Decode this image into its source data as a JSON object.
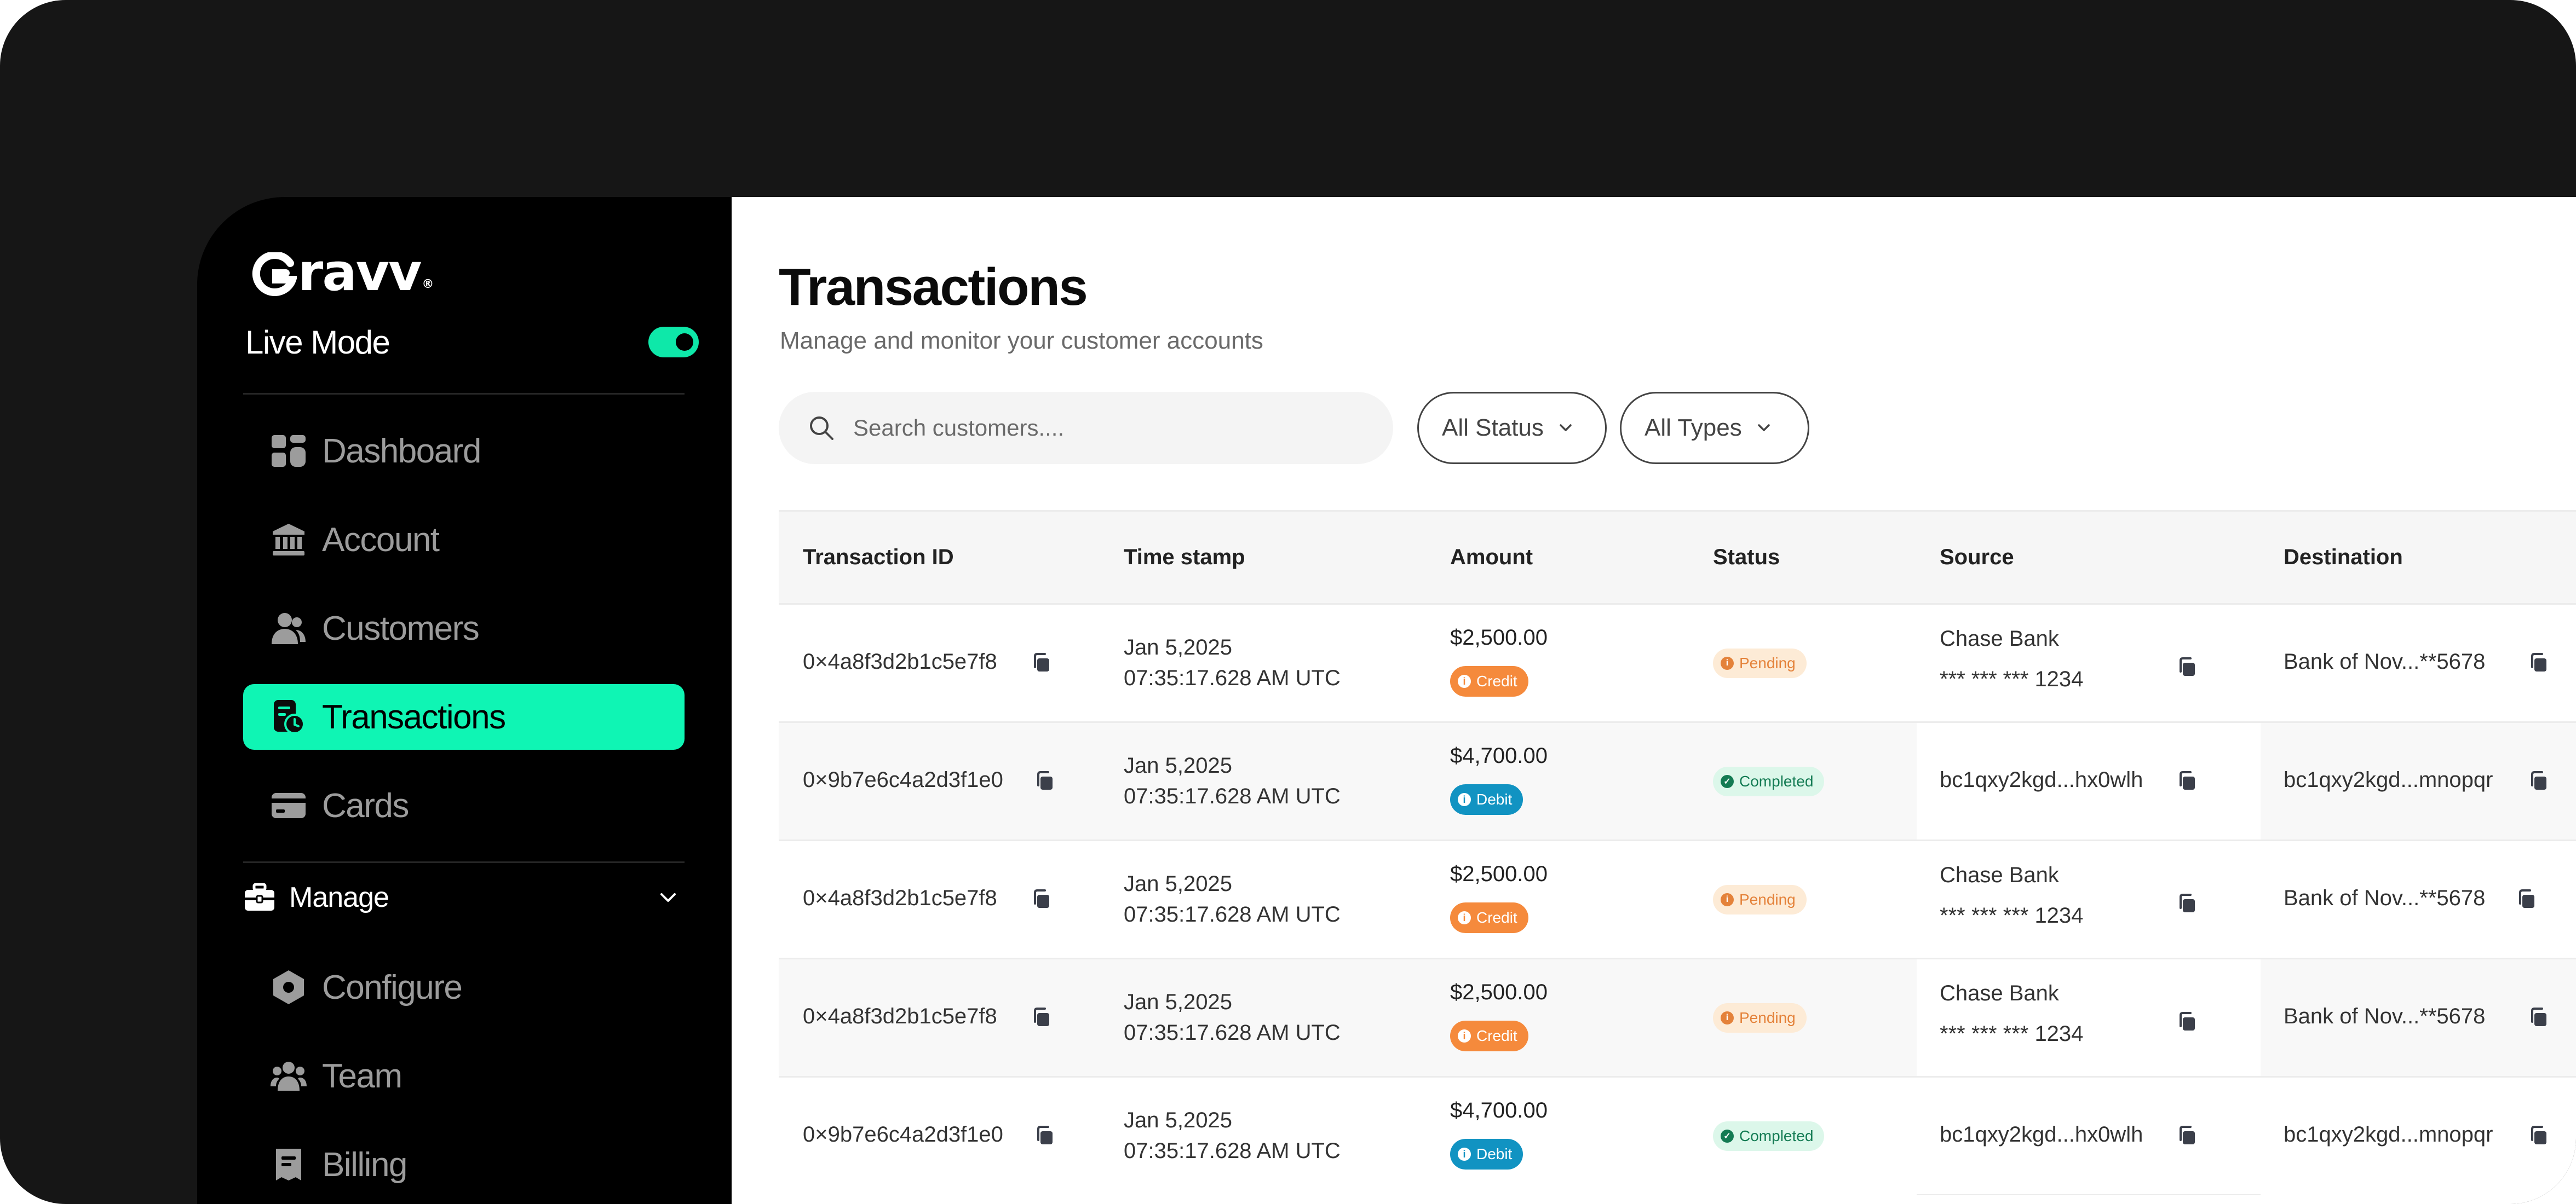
{
  "brand": {
    "name": "Gravv",
    "accent": "#0ff5b4"
  },
  "live_mode": {
    "label": "Live Mode",
    "enabled": true
  },
  "sidebar": {
    "items": [
      {
        "label": "Dashboard",
        "icon": "dashboard-icon"
      },
      {
        "label": "Account",
        "icon": "bank-icon"
      },
      {
        "label": "Customers",
        "icon": "customers-icon"
      },
      {
        "label": "Transactions",
        "icon": "transactions-icon",
        "active": true
      },
      {
        "label": "Cards",
        "icon": "card-icon"
      }
    ],
    "manage": {
      "label": "Manage",
      "icon": "briefcase-icon",
      "items": [
        {
          "label": "Configure",
          "icon": "hexagon-icon"
        },
        {
          "label": "Team",
          "icon": "team-icon"
        },
        {
          "label": "Billing",
          "icon": "billing-icon"
        }
      ]
    }
  },
  "page": {
    "title": "Transactions",
    "subtitle": "Manage and monitor your customer accounts"
  },
  "search": {
    "placeholder": "Search customers...."
  },
  "filters": {
    "status": "All Status",
    "types": "All Types"
  },
  "table": {
    "columns": [
      "Transaction ID",
      "Time stamp",
      "Amount",
      "Status",
      "Source",
      "Destination"
    ],
    "rows": [
      {
        "id": "0×4a8f3d2b1c5e7f8",
        "date": "Jan 5,2025",
        "time": "07:35:17.628 AM UTC",
        "amount": "$2,500.00",
        "type": "Credit",
        "status": "Pending",
        "source_name": "Chase Bank",
        "source_account": "*** *** *** 1234",
        "destination": "Bank of Nov...**5678"
      },
      {
        "id": "0×9b7e6c4a2d3f1e0",
        "date": "Jan 5,2025",
        "time": "07:35:17.628 AM UTC",
        "amount": "$4,700.00",
        "type": "Debit",
        "status": "Completed",
        "source_name": "",
        "source_account": "bc1qxy2kgd...hx0wlh",
        "destination": "bc1qxy2kgd...mnopqr"
      },
      {
        "id": "0×4a8f3d2b1c5e7f8",
        "date": "Jan 5,2025",
        "time": "07:35:17.628 AM UTC",
        "amount": "$2,500.00",
        "type": "Credit",
        "status": "Pending",
        "source_name": "Chase Bank",
        "source_account": "*** *** *** 1234",
        "destination": "Bank of Nov...**5678"
      },
      {
        "id": "0×4a8f3d2b1c5e7f8",
        "date": "Jan 5,2025",
        "time": "07:35:17.628 AM UTC",
        "amount": "$2,500.00",
        "type": "Credit",
        "status": "Pending",
        "source_name": "Chase Bank",
        "source_account": "*** *** *** 1234",
        "destination": "Bank of Nov...**5678"
      },
      {
        "id": "0×9b7e6c4a2d3f1e0",
        "date": "Jan 5,2025",
        "time": "07:35:17.628 AM UTC",
        "amount": "$4,700.00",
        "type": "Debit",
        "status": "Completed",
        "source_name": "",
        "source_account": "bc1qxy2kgd...hx0wlh",
        "destination": "bc1qxy2kgd...mnopqr"
      }
    ]
  },
  "colors": {
    "credit": "#f58a3c",
    "debit": "#1193c2",
    "pending_bg": "#fdebd6",
    "pending_fg": "#e4823a",
    "completed_bg": "#dcf7ea",
    "completed_fg": "#137b53"
  }
}
